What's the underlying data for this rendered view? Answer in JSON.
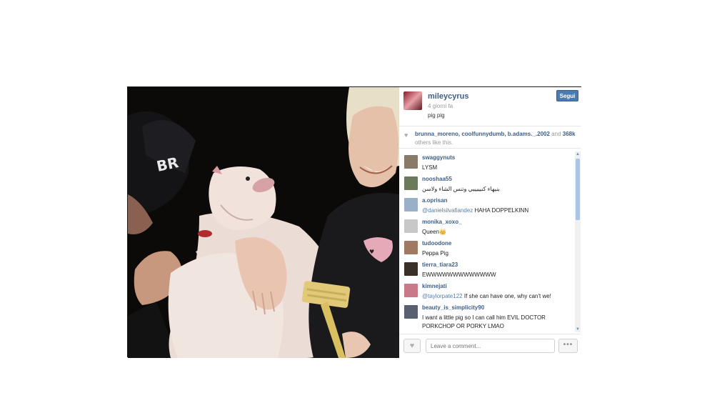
{
  "post": {
    "username": "mileycyrus",
    "time_ago": "4 giorni fa",
    "caption": "pig pig",
    "follow_label": "Segui"
  },
  "likes": {
    "users": "brunna_moreno, coolfunnydumb, b.adams._.2002",
    "and": "and",
    "count": "368k",
    "suffix": "others like this."
  },
  "comments": [
    {
      "user": "swaggynuts",
      "mention": "",
      "text": "LYSM",
      "avatar_color": "#8a7a6a"
    },
    {
      "user": "nooshaa55",
      "mention": "",
      "text": "بنيهاء كنيييييي وتنس الشاء ولاسن",
      "avatar_color": "#6a7a5a"
    },
    {
      "user": "a.oprisan",
      "mention": "@danielsilvafiandez",
      "text": "HAHA DOPPELKINN",
      "avatar_color": "#9ab0c8"
    },
    {
      "user": "monika_xoxo_",
      "mention": "",
      "text": "Queen👑",
      "avatar_color": "#c8c8c8"
    },
    {
      "user": "tudoodone",
      "mention": "",
      "text": "Peppa Pig",
      "avatar_color": "#a07a60"
    },
    {
      "user": "tierra_tiara23",
      "mention": "",
      "text": "EWWWWWWWWWWWWW",
      "avatar_color": "#3a3028"
    },
    {
      "user": "kimnejati",
      "mention": "@taylorpate122",
      "text": "If she can have one, why can't we!",
      "avatar_color": "#c87a8a"
    },
    {
      "user": "beauty_is_simplicity90",
      "mention": "",
      "text": "I want a little pig so I can call him EVIL DOCTOR PORKCHOP OR PORKY LMAO",
      "avatar_color": "#5a6070"
    }
  ],
  "footer": {
    "comment_placeholder": "Leave a comment...",
    "more_label": "•••",
    "like_icon": "heart-icon"
  },
  "colors": {
    "link": "#3f5f86",
    "follow_button": "#4a7bb0",
    "photo_bg": "#0b0a09"
  }
}
